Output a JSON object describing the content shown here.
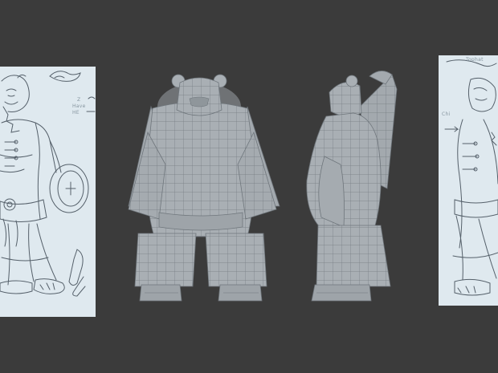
{
  "scene": {
    "background": "#3b3b3b",
    "sketch_paper_color": "#dfe9ef",
    "model_color": "#a7adb2",
    "wire_color": "#6f767c"
  },
  "sketch_left": {
    "notes": [
      "Z",
      "Have",
      "HE"
    ]
  },
  "sketch_right": {
    "notes": [
      "Tophat",
      "Chi"
    ]
  }
}
